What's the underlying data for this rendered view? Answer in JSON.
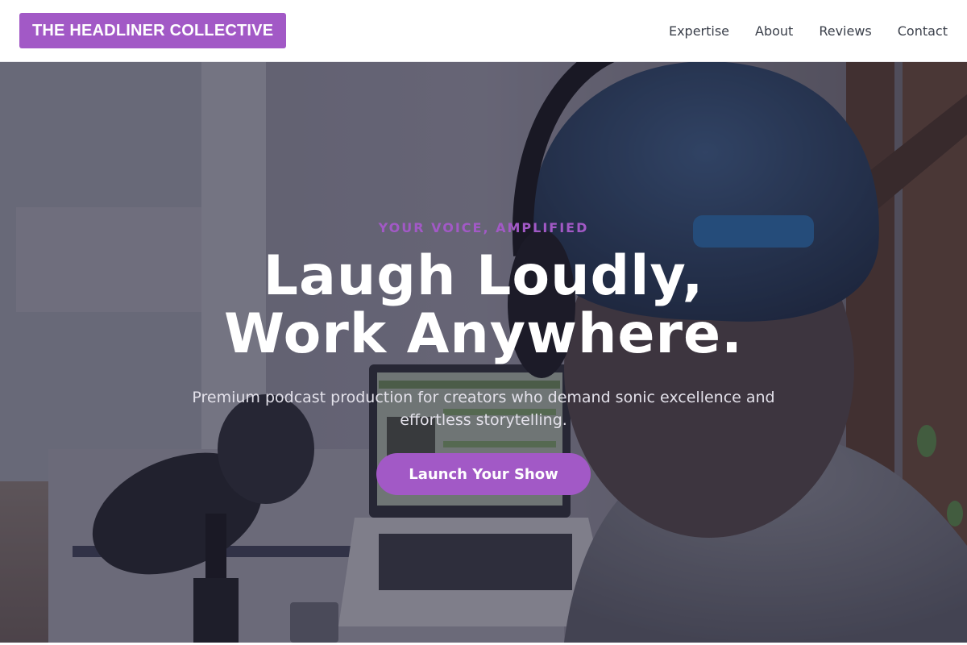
{
  "header": {
    "logo_text": "THE HEADLINER COLLECTIVE",
    "nav": [
      {
        "label": "Expertise"
      },
      {
        "label": "About"
      },
      {
        "label": "Reviews"
      },
      {
        "label": "Contact"
      }
    ]
  },
  "hero": {
    "eyebrow": "YOUR VOICE, AMPLIFIED",
    "headline_line1": "Laugh Loudly,",
    "headline_line2": "Work Anywhere.",
    "subtitle": "Premium podcast production for creators who demand sonic excellence and effortless storytelling.",
    "cta_label": "Launch Your Show",
    "background_image": "podcaster-with-headphones-and-microphone"
  },
  "colors": {
    "accent": "#a259c6",
    "nav_text": "#3a3f4a",
    "overlay": "#1e1c30"
  }
}
